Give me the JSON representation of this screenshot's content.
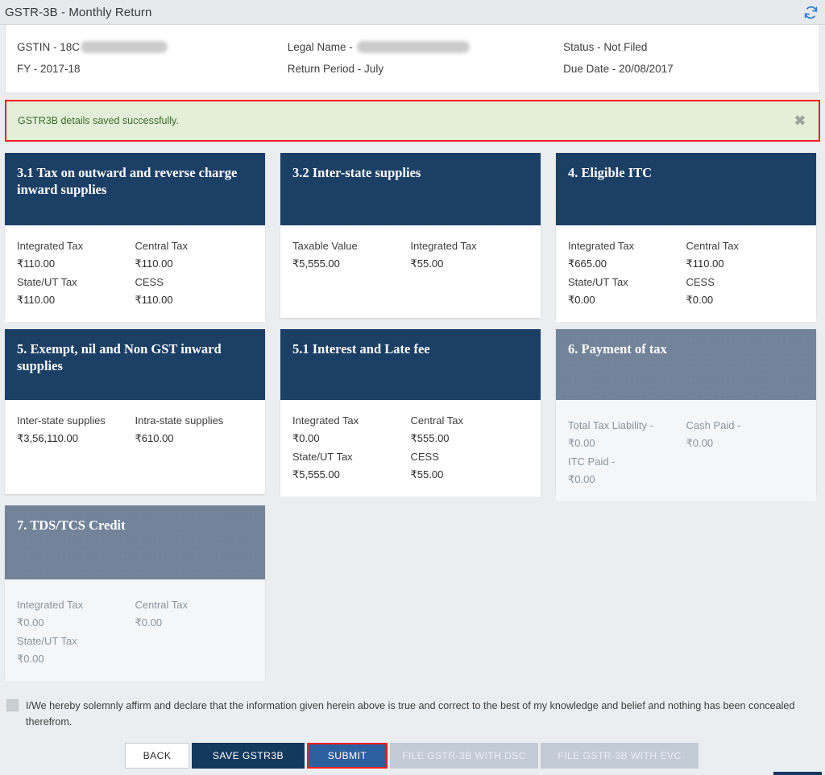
{
  "titlebar": {
    "title": "GSTR-3B - Monthly Return",
    "refresh_icon": "refresh-icon"
  },
  "profile": {
    "gstin_label": "GSTIN - 18C",
    "fy_label": "FY - 2017-18",
    "legal_name_label": "Legal Name - ",
    "return_period_label": "Return Period - July",
    "status_label": "Status - Not Filed",
    "due_date_label": "Due Date - 20/08/2017"
  },
  "alert": {
    "message": "GSTR3B details saved successfully.",
    "close_icon": "✖",
    "background_color": "#e3efd8",
    "border_color": "#fa1c1c",
    "text_color": "#3d6b2a"
  },
  "tiles": [
    {
      "title": "3.1 Tax on outward and reverse charge inward supplies",
      "disabled": false,
      "fields": [
        {
          "label": "Integrated Tax",
          "value": "₹110.00"
        },
        {
          "label": "Central Tax",
          "value": "₹110.00"
        },
        {
          "label": "State/UT Tax",
          "value": "₹110.00"
        },
        {
          "label": "CESS",
          "value": "₹110.00"
        }
      ]
    },
    {
      "title": "3.2 Inter-state supplies",
      "disabled": false,
      "fields": [
        {
          "label": "Taxable Value",
          "value": "₹5,555.00"
        },
        {
          "label": "Integrated Tax",
          "value": "₹55.00"
        }
      ]
    },
    {
      "title": "4. Eligible ITC",
      "disabled": false,
      "fields": [
        {
          "label": "Integrated Tax",
          "value": "₹665.00"
        },
        {
          "label": "Central Tax",
          "value": "₹110.00"
        },
        {
          "label": "State/UT Tax",
          "value": "₹0.00"
        },
        {
          "label": "CESS",
          "value": "₹0.00"
        }
      ]
    },
    {
      "title": "5. Exempt, nil and Non GST inward supplies",
      "disabled": false,
      "fields": [
        {
          "label": "Inter-state supplies",
          "value": "₹3,56,110.00"
        },
        {
          "label": "Intra-state supplies",
          "value": "₹610.00"
        }
      ]
    },
    {
      "title": "5.1 Interest and Late fee",
      "disabled": false,
      "fields": [
        {
          "label": "Integrated Tax",
          "value": "₹0.00"
        },
        {
          "label": "Central Tax",
          "value": "₹555.00"
        },
        {
          "label": "State/UT Tax",
          "value": "₹5,555.00"
        },
        {
          "label": "CESS",
          "value": "₹55.00"
        }
      ]
    },
    {
      "title": "6. Payment of tax",
      "disabled": true,
      "fields": [
        {
          "label": "Total Tax Liability -",
          "value": "₹0.00"
        },
        {
          "label": "Cash Paid -",
          "value": "₹0.00"
        },
        {
          "label": "ITC Paid -",
          "value": "₹0.00"
        }
      ]
    },
    {
      "title": "7. TDS/TCS Credit",
      "disabled": true,
      "fields": [
        {
          "label": "Integrated Tax",
          "value": "₹0.00"
        },
        {
          "label": "Central Tax",
          "value": "₹0.00"
        },
        {
          "label": "State/UT Tax",
          "value": "₹0.00"
        }
      ]
    }
  ],
  "declaration": {
    "text": "I/We hereby solemnly affirm and declare that the information given herein above is true and correct to the best of my knowledge and belief and nothing has been concealed therefrom.",
    "checked": false
  },
  "actions": {
    "back": "BACK",
    "save": "SAVE GSTR3B",
    "submit": "SUBMIT",
    "file_dsc": "FILE GSTR-3B WITH DSC",
    "file_evc": "FILE GSTR-3B WITH EVC",
    "submit_highlight_color": "#fa1c1c"
  },
  "theme": {
    "tile_header_navy": "#1c3f66",
    "tile_header_disabled": "#73839a",
    "page_background": "#ebeef0",
    "button_navy": "#14395f",
    "button_blue": "#2c5f9e"
  }
}
